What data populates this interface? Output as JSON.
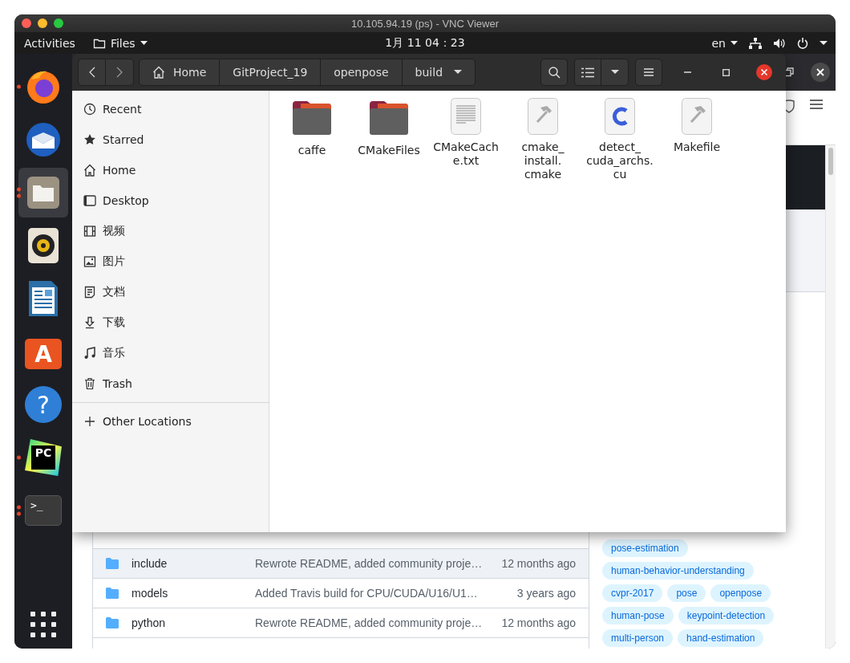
{
  "vnc_window": {
    "title": "10.105.94.19 (ps) - VNC Viewer"
  },
  "top_bar": {
    "activities": "Activities",
    "app_menu": "Files",
    "clock": "1月 11  04：23",
    "keyboard_layout": "en"
  },
  "dock": {
    "apps": [
      {
        "kind": "firefox",
        "selected": false,
        "running": true,
        "several_windows": false
      },
      {
        "kind": "thunderbird",
        "selected": false,
        "running": false
      },
      {
        "kind": "files",
        "selected": true,
        "running": true,
        "several_windows": true
      },
      {
        "kind": "rhythmbox",
        "selected": false,
        "running": false
      },
      {
        "kind": "writer",
        "selected": false,
        "running": false
      },
      {
        "kind": "software",
        "selected": false,
        "running": false,
        "glyph": "A"
      },
      {
        "kind": "help",
        "selected": false,
        "running": false,
        "glyph": "?"
      },
      {
        "kind": "pycharm",
        "selected": false,
        "running": true,
        "several_windows": false,
        "glyph": "PC"
      },
      {
        "kind": "terminal",
        "selected": false,
        "running": true,
        "several_windows": true,
        "glyph": ">_"
      }
    ]
  },
  "files_window": {
    "path": [
      {
        "label": "Home",
        "kind": "home",
        "selected": false
      },
      {
        "label": "GitProject_19",
        "kind": "folder",
        "selected": false
      },
      {
        "label": "openpose",
        "kind": "folder",
        "selected": false
      },
      {
        "label": "build",
        "kind": "folder",
        "selected": true
      }
    ],
    "sidebar": {
      "places": [
        {
          "label": "Recent"
        },
        {
          "label": "Starred"
        },
        {
          "label": "Home"
        },
        {
          "label": "Desktop"
        },
        {
          "label": "视频"
        },
        {
          "label": "图片"
        },
        {
          "label": "文档"
        },
        {
          "label": "下载"
        },
        {
          "label": "音乐"
        },
        {
          "label": "Trash"
        }
      ],
      "other_locations": "Other Locations"
    },
    "files": [
      {
        "lines": [
          "caffe"
        ],
        "kind": "folder"
      },
      {
        "lines": [
          "CMakeFiles"
        ],
        "kind": "folder"
      },
      {
        "lines": [
          "CMakeCach",
          "e.txt"
        ],
        "kind": "text"
      },
      {
        "lines": [
          "cmake_",
          "install.",
          "cmake"
        ],
        "kind": "script"
      },
      {
        "lines": [
          "detect_",
          "cuda_archs.",
          "cu"
        ],
        "kind": "c-source"
      },
      {
        "lines": [
          "Makefile"
        ],
        "kind": "script"
      }
    ]
  },
  "browser": {
    "files_table": {
      "rows": [
        {
          "name": "include",
          "message": "Rewrote README, added community proje…",
          "time": "12 months ago",
          "highlighted": true
        },
        {
          "name": "models",
          "message": "Added Travis build for CPU/CUDA/U16/U1…",
          "time": "3 years ago",
          "highlighted": false
        },
        {
          "name": "python",
          "message": "Rewrote README, added community proje…",
          "time": "12 months ago",
          "highlighted": false
        }
      ]
    },
    "topics": [
      "pose-estimation",
      "human-behavior-understanding",
      "cvpr-2017",
      "pose",
      "openpose",
      "human-pose",
      "keypoint-detection",
      "multi-person",
      "hand-estimation"
    ]
  }
}
